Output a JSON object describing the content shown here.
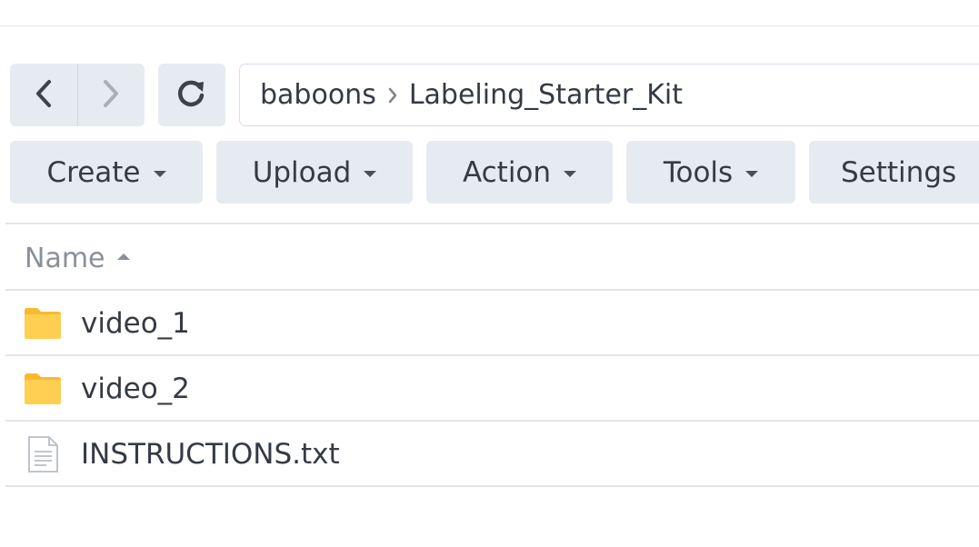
{
  "nav": {
    "back_icon": "chevron-left-icon",
    "forward_icon": "chevron-right-icon",
    "refresh_icon": "refresh-icon"
  },
  "breadcrumb": {
    "items": [
      "baboons",
      "Labeling_Starter_Kit"
    ],
    "separator_icon": "chevron-right-icon"
  },
  "toolbar": {
    "create_label": "Create",
    "upload_label": "Upload",
    "action_label": "Action",
    "tools_label": "Tools",
    "settings_label": "Settings"
  },
  "file_list": {
    "header": "Name",
    "sort": "ascending",
    "rows": [
      {
        "name": "video_1",
        "type": "folder",
        "icon": "folder-icon"
      },
      {
        "name": "video_2",
        "type": "folder",
        "icon": "folder-icon"
      },
      {
        "name": "INSTRUCTIONS.txt",
        "type": "file",
        "icon": "text-file-icon"
      }
    ]
  },
  "colors": {
    "button_bg": "#e6ebf2",
    "folder": "#ffc94a",
    "text": "#353b45",
    "muted": "#8a9099"
  }
}
